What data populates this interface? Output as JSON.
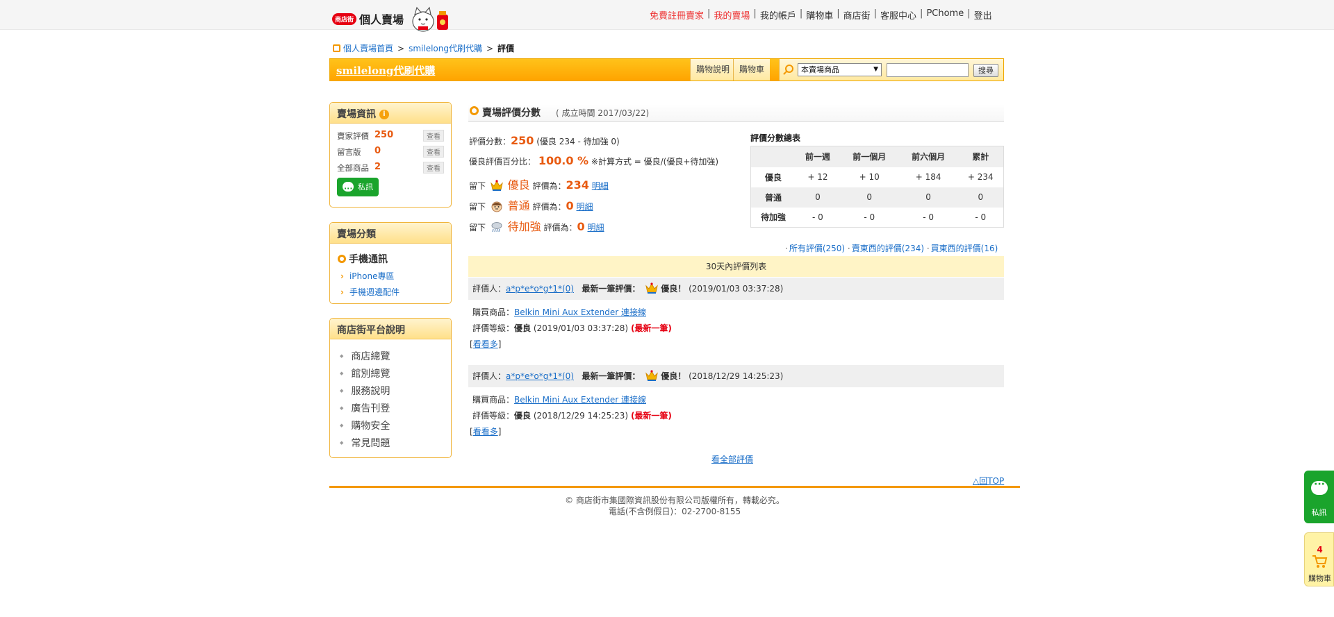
{
  "header": {
    "logo_badge": "商店街",
    "logo_text": "個人賣場",
    "nav": [
      {
        "label": "免費註冊賣家",
        "red": true
      },
      {
        "label": "我的賣場",
        "red": true
      },
      {
        "label": "我的帳戶",
        "red": false
      },
      {
        "label": "購物車",
        "red": false
      },
      {
        "label": "商店街",
        "red": false
      },
      {
        "label": "客服中心",
        "red": false
      },
      {
        "label": "PChome",
        "red": false
      },
      {
        "label": "登出",
        "red": false
      }
    ]
  },
  "breadcrumb": {
    "home": "個人賣場首頁",
    "store": "smilelong代刷代購",
    "current": "評價",
    "sep": ">"
  },
  "storebar": {
    "name": "smilelong代刷代購",
    "help_label": "購物說明",
    "cart_label": "購物車",
    "scope_value": "本賣場商品",
    "search_button": "搜尋"
  },
  "sidebar": {
    "info": {
      "title": "賣場資訊",
      "info_icon": "i",
      "rows": [
        {
          "label": "賣家評價",
          "value": "250",
          "action": "查看"
        },
        {
          "label": "留言版",
          "value": "0",
          "action": "查看"
        },
        {
          "label": "全部商品",
          "value": "2",
          "action": "查看"
        }
      ],
      "pm_label": "私訊"
    },
    "category": {
      "title": "賣場分類",
      "main": "手機通訊",
      "subs": [
        "iPhone專區",
        "手機週邊配件"
      ]
    },
    "platform": {
      "title": "商店街平台說明",
      "items": [
        "商店總覽",
        "館別總覽",
        "服務說明",
        "廣告刊登",
        "購物安全",
        "常見問題"
      ]
    }
  },
  "score": {
    "title": "賣場評價分數",
    "established": "( 成立時間 2017/03/22)",
    "score_label": "評價分數：",
    "score_value": "250",
    "score_detail": "(優良 234 - 待加強 0)",
    "pct_label": "優良評價百分比：",
    "pct_value": "100.0 %",
    "pct_note": "※計算方式 = 優良/(優良+待加強)",
    "leave": "留下",
    "rating_is": "評價為：",
    "detail_link": "明細",
    "ratings": [
      {
        "grade": "優良",
        "count": "234",
        "icon": "crown-icon"
      },
      {
        "grade": "普通",
        "count": "0",
        "icon": "face-icon"
      },
      {
        "grade": "待加強",
        "count": "0",
        "icon": "rain-icon"
      }
    ],
    "colors": {
      "accent": "#f39800",
      "score": "#e85a10"
    }
  },
  "summary": {
    "title": "評價分數總表",
    "columns": [
      "",
      "前一週",
      "前一個月",
      "前六個月",
      "累計"
    ],
    "rows": [
      [
        "優良",
        "+ 12",
        "+ 10",
        "+ 184",
        "+ 234"
      ],
      [
        "普通",
        "0",
        "0",
        "0",
        "0"
      ],
      [
        "待加強",
        "- 0",
        "- 0",
        "- 0",
        "- 0"
      ]
    ]
  },
  "filters": {
    "all": "所有評價(250)",
    "sell": "賣東西的評價(234)",
    "buy": "買東西的評價(16)"
  },
  "list": {
    "title": "30天內評價列表",
    "reviewer_label": "評價人：",
    "latest_label": "最新一筆評價：",
    "product_label": "購買商品：",
    "grade_label": "評價等級：",
    "more": "看看多",
    "items": [
      {
        "reviewer": "a*p*e*o*g*1*(0)",
        "grade": "優良！",
        "time": "(2019/01/03 03:37:28)",
        "product": "Belkin Mini Aux Extender 連接線",
        "level": "優良",
        "level_time": "(2019/01/03 03:37:28)",
        "latest": "(最新一筆)"
      },
      {
        "reviewer": "a*p*e*o*g*1*(0)",
        "grade": "優良！",
        "time": "(2018/12/29 14:25:23)",
        "product": "Belkin Mini Aux Extender 連接線",
        "level": "優良",
        "level_time": "(2018/12/29 14:25:23)",
        "latest": "(最新一筆)"
      }
    ]
  },
  "all_reviews": "看全部評價",
  "back_top": "△回TOP",
  "footer": {
    "line1": "© 商店街市集國際資訊股份有限公司版權所有，轉載必究。",
    "line2": "電話(不含例假日)：02-2700-8155"
  },
  "float": {
    "pm_label": "私訊",
    "cart_count": "4",
    "cart_label": "購物車"
  }
}
